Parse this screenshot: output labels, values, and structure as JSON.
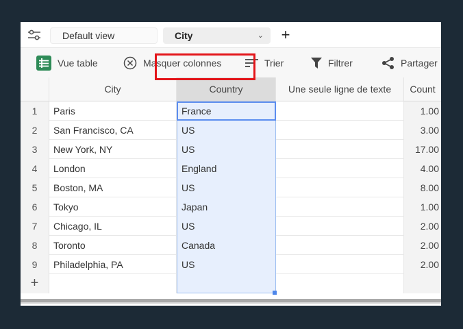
{
  "topbar": {
    "view_label": "Default view",
    "table_select": "City",
    "add_label": "+"
  },
  "toolbar": {
    "items": [
      {
        "label": "Vue table",
        "icon": "table-icon"
      },
      {
        "label": "Masquer colonnes",
        "icon": "hide-columns-icon"
      },
      {
        "label": "Trier",
        "icon": "sort-icon"
      },
      {
        "label": "Filtrer",
        "icon": "filter-icon"
      },
      {
        "label": "Partager",
        "icon": "share-icon"
      }
    ]
  },
  "grid": {
    "columns": [
      "City",
      "Country",
      "Une seule ligne de texte",
      "Count"
    ],
    "rows": [
      {
        "num": "1",
        "city": "Paris",
        "country": "France",
        "text": "",
        "count": "1.00"
      },
      {
        "num": "2",
        "city": "San Francisco, CA",
        "country": "US",
        "text": "",
        "count": "3.00"
      },
      {
        "num": "3",
        "city": "New York, NY",
        "country": "US",
        "text": "",
        "count": "17.00"
      },
      {
        "num": "4",
        "city": "London",
        "country": "England",
        "text": "",
        "count": "4.00"
      },
      {
        "num": "5",
        "city": "Boston, MA",
        "country": "US",
        "text": "",
        "count": "8.00"
      },
      {
        "num": "6",
        "city": "Tokyo",
        "country": "Japan",
        "text": "",
        "count": "1.00"
      },
      {
        "num": "7",
        "city": "Chicago, IL",
        "country": "US",
        "text": "",
        "count": "2.00"
      },
      {
        "num": "8",
        "city": "Toronto",
        "country": "Canada",
        "text": "",
        "count": "2.00"
      },
      {
        "num": "9",
        "city": "Philadelphia, PA",
        "country": "US",
        "text": "",
        "count": "2.00"
      }
    ],
    "add_row_label": "+"
  },
  "colors": {
    "background": "#1c2a36",
    "table_icon_green": "#2e8b57",
    "selection_blue": "#e7effd",
    "highlight_red": "#e3151a"
  }
}
